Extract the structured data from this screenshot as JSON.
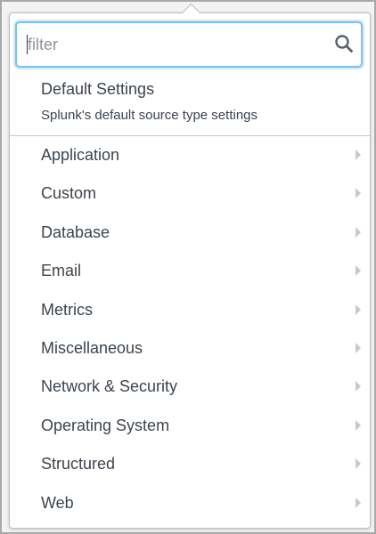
{
  "search": {
    "placeholder": "filter",
    "value": ""
  },
  "default_settings": {
    "title": "Default Settings",
    "description": "Splunk's default source type settings"
  },
  "categories": [
    {
      "label": "Application",
      "icon": "chevron-right-icon"
    },
    {
      "label": "Custom",
      "icon": "chevron-right-icon"
    },
    {
      "label": "Database",
      "icon": "chevron-right-icon"
    },
    {
      "label": "Email",
      "icon": "chevron-right-icon"
    },
    {
      "label": "Metrics",
      "icon": "chevron-right-icon"
    },
    {
      "label": "Miscellaneous",
      "icon": "chevron-right-icon"
    },
    {
      "label": "Network & Security",
      "icon": "chevron-right-icon"
    },
    {
      "label": "Operating System",
      "icon": "chevron-right-icon"
    },
    {
      "label": "Structured",
      "icon": "chevron-right-icon"
    },
    {
      "label": "Web",
      "icon": "chevron-right-icon"
    }
  ],
  "colors": {
    "text": "#3c444d",
    "focus_border": "#7cc1ec",
    "chevron": "#c6c9cc",
    "divider": "#c8c8c8"
  }
}
